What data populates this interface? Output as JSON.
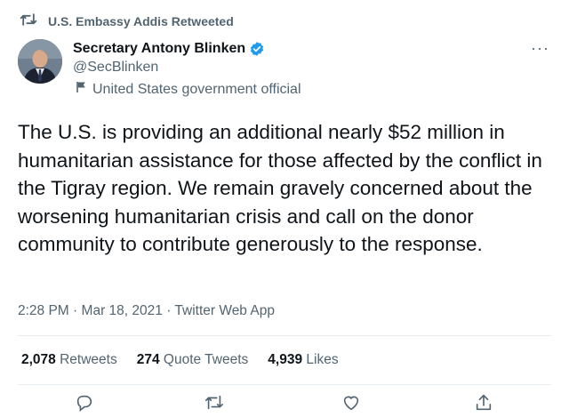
{
  "retweet": {
    "icon": "retweet-icon",
    "text": "U.S. Embassy Addis Retweeted"
  },
  "author": {
    "display_name": "Secretary Antony Blinken",
    "handle": "@SecBlinken",
    "label": "United States government official",
    "verified_color": "#1d9bf0"
  },
  "tweet": {
    "text": "The U.S. is providing an additional nearly $52 million in humanitarian assistance for those affected by the conflict in the Tigray region. We remain gravely concerned about the worsening humanitarian crisis and call on the donor community to contribute generously to the response.",
    "time": "2:28 PM",
    "sep1": "·",
    "date": "Mar 18, 2021",
    "sep2": "·",
    "source": "Twitter Web App"
  },
  "stats": {
    "retweets_count": "2,078",
    "retweets_label": "Retweets",
    "quotes_count": "274",
    "quotes_label": "Quote Tweets",
    "likes_count": "4,939",
    "likes_label": "Likes"
  },
  "more_label": "···",
  "actions": [
    "reply-icon",
    "retweet-icon",
    "like-icon",
    "share-icon"
  ]
}
